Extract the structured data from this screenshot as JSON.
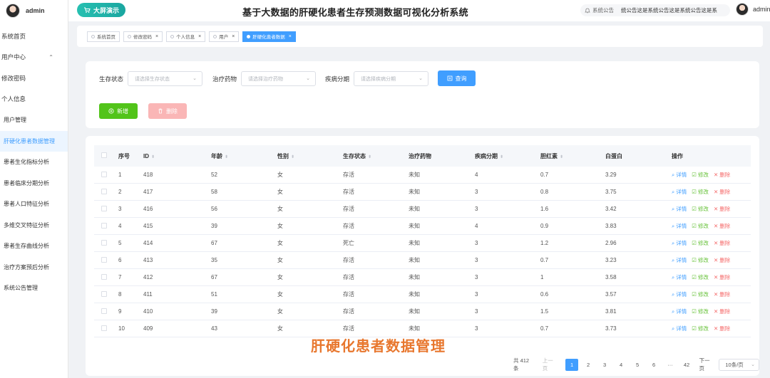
{
  "sidebar": {
    "username": "admin",
    "items": [
      {
        "label": "系统首页",
        "sub": false
      },
      {
        "label": "用户中心",
        "sub": false,
        "expanded": true
      },
      {
        "label": "修改密码",
        "sub": false
      },
      {
        "label": "个人信息",
        "sub": false
      },
      {
        "label": "用户管理",
        "sub": true
      },
      {
        "label": "肝硬化患者数据管理",
        "sub": true,
        "active": true
      },
      {
        "label": "患者生化指标分析",
        "sub": true
      },
      {
        "label": "患者临床分期分析",
        "sub": true
      },
      {
        "label": "患者人口特征分析",
        "sub": true
      },
      {
        "label": "多维交叉特征分析",
        "sub": true
      },
      {
        "label": "患者生存曲线分析",
        "sub": true
      },
      {
        "label": "治疗方案预后分析",
        "sub": true
      },
      {
        "label": "系统公告管理",
        "sub": true
      }
    ]
  },
  "header": {
    "bigscreen_label": "大屏演示",
    "title": "基于大数据的肝硬化患者生存预测数据可视化分析系统",
    "notice_label": "系统公告",
    "notice_text": "统公告这是系统公告这是系统公告这是系",
    "username": "admin"
  },
  "tags": [
    {
      "label": "系统首页",
      "closable": false,
      "active": false
    },
    {
      "label": "修改密码",
      "closable": true,
      "active": false
    },
    {
      "label": "个人信息",
      "closable": true,
      "active": false
    },
    {
      "label": "用户",
      "closable": true,
      "active": false
    },
    {
      "label": "肝硬化患者数据",
      "closable": true,
      "active": true
    }
  ],
  "search": {
    "status_label": "生存状态",
    "status_placeholder": "请选择生存状态",
    "drug_label": "治疗药物",
    "drug_placeholder": "请选择治疗药物",
    "stage_label": "疾病分期",
    "stage_placeholder": "请选择疾病分期",
    "query_label": "查询",
    "add_label": "新增",
    "delete_label": "删除"
  },
  "table": {
    "headers": [
      "序号",
      "ID",
      "年龄",
      "性别",
      "生存状态",
      "治疗药物",
      "疾病分期",
      "胆红素",
      "白蛋白",
      "操作"
    ],
    "actions": {
      "detail": "详情",
      "edit": "修改",
      "remove": "删除"
    },
    "rows": [
      [
        "1",
        "418",
        "52",
        "女",
        "存活",
        "未知",
        "4",
        "0.7",
        "3.29"
      ],
      [
        "2",
        "417",
        "58",
        "女",
        "存活",
        "未知",
        "3",
        "0.8",
        "3.75"
      ],
      [
        "3",
        "416",
        "56",
        "女",
        "存活",
        "未知",
        "3",
        "1.6",
        "3.42"
      ],
      [
        "4",
        "415",
        "39",
        "女",
        "存活",
        "未知",
        "4",
        "0.9",
        "3.83"
      ],
      [
        "5",
        "414",
        "67",
        "女",
        "死亡",
        "未知",
        "3",
        "1.2",
        "2.96"
      ],
      [
        "6",
        "413",
        "35",
        "女",
        "存活",
        "未知",
        "3",
        "0.7",
        "3.23"
      ],
      [
        "7",
        "412",
        "67",
        "女",
        "存活",
        "未知",
        "3",
        "1",
        "3.58"
      ],
      [
        "8",
        "411",
        "51",
        "女",
        "存活",
        "未知",
        "3",
        "0.6",
        "3.57"
      ],
      [
        "9",
        "410",
        "39",
        "女",
        "存活",
        "未知",
        "3",
        "1.5",
        "3.81"
      ],
      [
        "10",
        "409",
        "43",
        "女",
        "存活",
        "未知",
        "3",
        "0.7",
        "3.73"
      ]
    ]
  },
  "pagination": {
    "total": "共 412 条",
    "prev": "上一页",
    "pages": [
      "1",
      "2",
      "3",
      "4",
      "5",
      "6",
      "···",
      "42"
    ],
    "current": "1",
    "next": "下一页",
    "page_size": "10条/页"
  },
  "caption": "肝硬化患者数据管理",
  "colors": {
    "primary": "#409eff",
    "success": "#52c41a",
    "danger": "#f56c6c",
    "caption": "#e8772e",
    "teal": "#1aa6a0"
  }
}
